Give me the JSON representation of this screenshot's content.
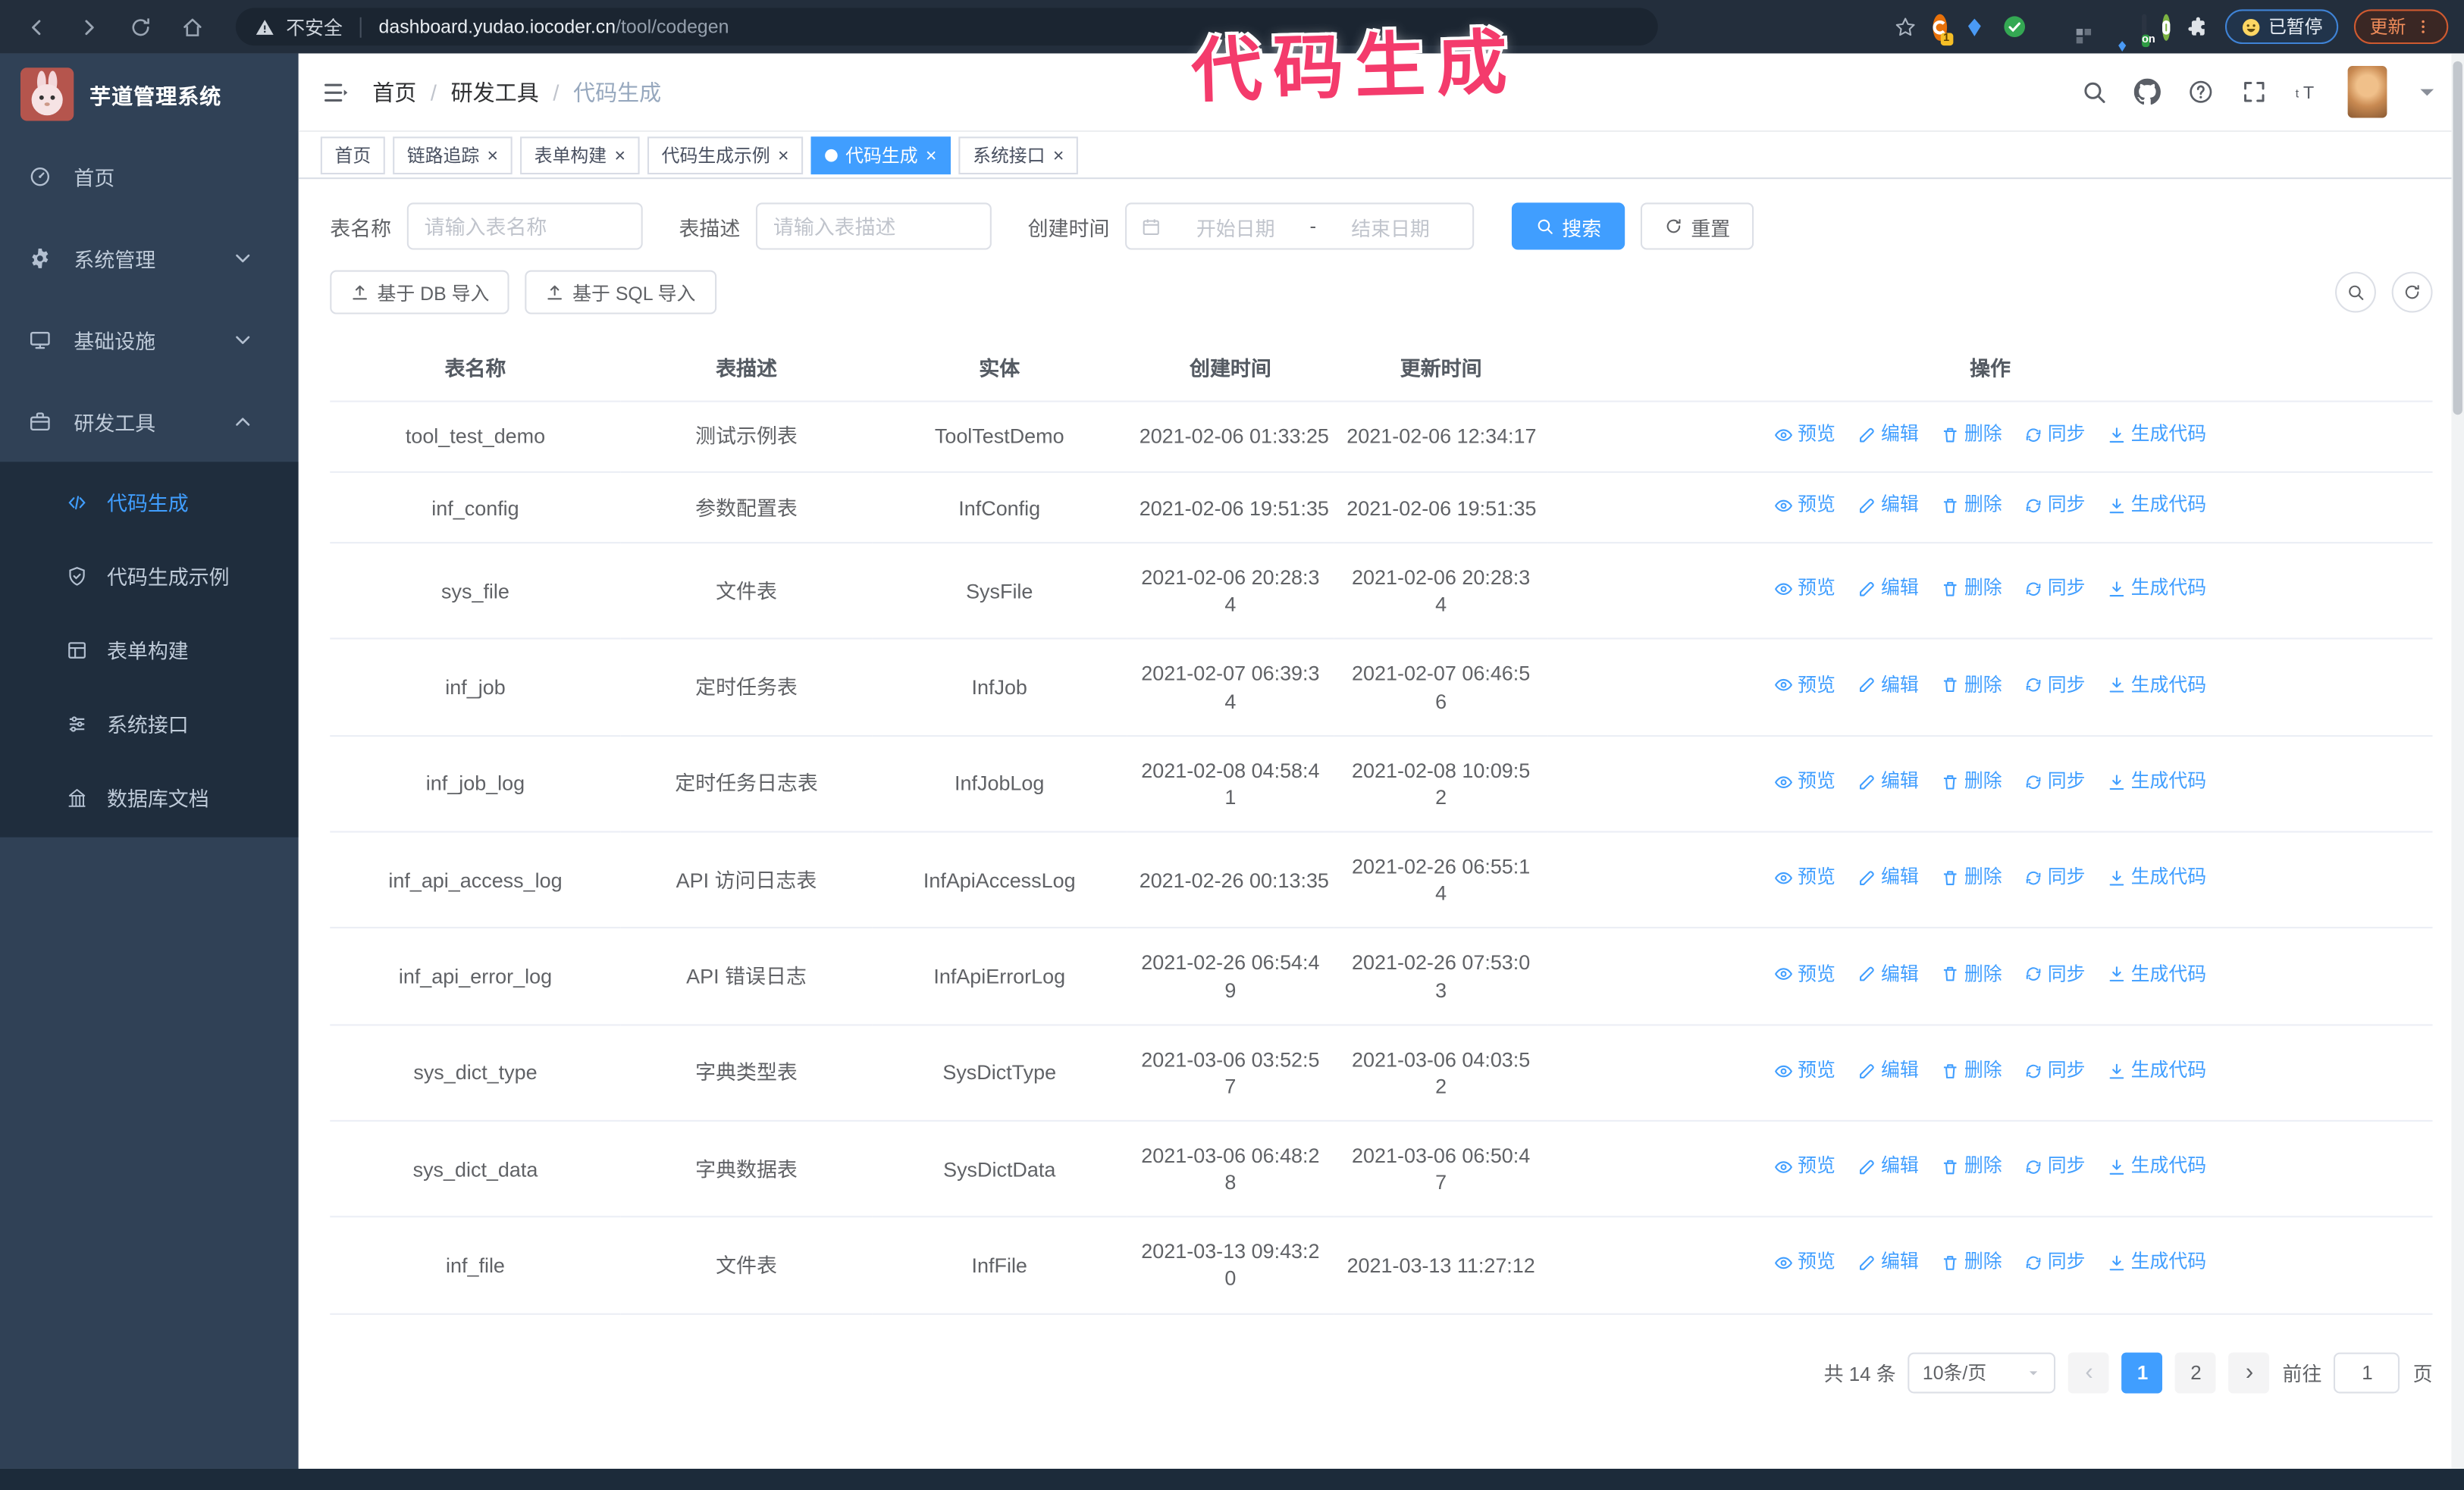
{
  "colors": {
    "accent": "#409eff",
    "sidebar_bg": "#304156",
    "submenu_bg": "#1f2d3d",
    "browser_toolbar_bg": "#232e3c",
    "annotation_pink": "#f43b6c",
    "active_tab_bg": "#409eff"
  },
  "annotation": {
    "text": "代码生成"
  },
  "browser": {
    "security_label": "不安全",
    "url_host": "dashboard.yudao.iocoder.cn",
    "url_path": "/tool/codegen",
    "ext_badge_count": "1",
    "ext_badge_on": "on",
    "paused_label": "已暂停",
    "update_label": "更新"
  },
  "sidebar": {
    "brand": "芋道管理系统",
    "menu": [
      {
        "icon": "dashboard-icon",
        "label": "首页"
      },
      {
        "icon": "gear-icon",
        "label": "系统管理",
        "chevron": "down"
      },
      {
        "icon": "monitor-icon",
        "label": "基础设施",
        "chevron": "down"
      },
      {
        "icon": "briefcase-icon",
        "label": "研发工具",
        "chevron": "up",
        "expanded": true,
        "children": [
          {
            "icon": "code-icon",
            "label": "代码生成",
            "active": true
          },
          {
            "icon": "shield-check-icon",
            "label": "代码生成示例"
          },
          {
            "icon": "form-icon",
            "label": "表单构建"
          },
          {
            "icon": "sliders-icon",
            "label": "系统接口"
          },
          {
            "icon": "columns-icon",
            "label": "数据库文档"
          }
        ]
      }
    ]
  },
  "navbar": {
    "breadcrumb": [
      "首页",
      "研发工具",
      "代码生成"
    ]
  },
  "tabs": [
    {
      "label": "首页",
      "closable": false,
      "active": false
    },
    {
      "label": "链路追踪",
      "closable": true,
      "active": false
    },
    {
      "label": "表单构建",
      "closable": true,
      "active": false
    },
    {
      "label": "代码生成示例",
      "closable": true,
      "active": false
    },
    {
      "label": "代码生成",
      "closable": true,
      "active": true
    },
    {
      "label": "系统接口",
      "closable": true,
      "active": false
    }
  ],
  "filters": {
    "table_name": {
      "label": "表名称",
      "placeholder": "请输入表名称"
    },
    "table_desc": {
      "label": "表描述",
      "placeholder": "请输入表描述"
    },
    "create_time": {
      "label": "创建时间",
      "start_placeholder": "开始日期",
      "separator": "-",
      "end_placeholder": "结束日期"
    },
    "search_label": "搜索",
    "reset_label": "重置"
  },
  "toolbar": {
    "import_db_label": "基于 DB 导入",
    "import_sql_label": "基于 SQL 导入"
  },
  "table": {
    "headers": [
      "表名称",
      "表描述",
      "实体",
      "创建时间",
      "更新时间",
      "操作"
    ],
    "row_actions": [
      {
        "name": "preview-link",
        "icon": "eye-icon",
        "label": "预览"
      },
      {
        "name": "edit-link",
        "icon": "edit-icon",
        "label": "编辑"
      },
      {
        "name": "delete-link",
        "icon": "delete-icon",
        "label": "删除"
      },
      {
        "name": "sync-link",
        "icon": "sync-icon",
        "label": "同步"
      },
      {
        "name": "generate-code-link",
        "icon": "download-icon",
        "label": "生成代码"
      }
    ],
    "rows": [
      {
        "name": "tool_test_demo",
        "desc": "测试示例表",
        "entity": "ToolTestDemo",
        "created": "2021-02-06 01:33:25",
        "updated": "2021-02-06 12:34:17"
      },
      {
        "name": "inf_config",
        "desc": "参数配置表",
        "entity": "InfConfig",
        "created": "2021-02-06 19:51:35",
        "updated": "2021-02-06 19:51:35"
      },
      {
        "name": "sys_file",
        "desc": "文件表",
        "entity": "SysFile",
        "created": "2021-02-06 20:28:34",
        "updated": "2021-02-06 20:28:34"
      },
      {
        "name": "inf_job",
        "desc": "定时任务表",
        "entity": "InfJob",
        "created": "2021-02-07 06:39:34",
        "updated": "2021-02-07 06:46:56"
      },
      {
        "name": "inf_job_log",
        "desc": "定时任务日志表",
        "entity": "InfJobLog",
        "created": "2021-02-08 04:58:41",
        "updated": "2021-02-08 10:09:52"
      },
      {
        "name": "inf_api_access_log",
        "desc": "API 访问日志表",
        "entity": "InfApiAccessLog",
        "created": "2021-02-26 00:13:35",
        "updated": "2021-02-26 06:55:14"
      },
      {
        "name": "inf_api_error_log",
        "desc": "API 错误日志",
        "entity": "InfApiErrorLog",
        "created": "2021-02-26 06:54:49",
        "updated": "2021-02-26 07:53:03"
      },
      {
        "name": "sys_dict_type",
        "desc": "字典类型表",
        "entity": "SysDictType",
        "created": "2021-03-06 03:52:57",
        "updated": "2021-03-06 04:03:52"
      },
      {
        "name": "sys_dict_data",
        "desc": "字典数据表",
        "entity": "SysDictData",
        "created": "2021-03-06 06:48:28",
        "updated": "2021-03-06 06:50:47"
      },
      {
        "name": "inf_file",
        "desc": "文件表",
        "entity": "InfFile",
        "created": "2021-03-13 09:43:20",
        "updated": "2021-03-13 11:27:12"
      }
    ]
  },
  "pagination": {
    "total_label": "共 14 条",
    "page_size_label": "10条/页",
    "pages": [
      "1",
      "2"
    ],
    "active_page": "1",
    "goto_label": "前往",
    "goto_value": "1",
    "unit_label": "页"
  }
}
